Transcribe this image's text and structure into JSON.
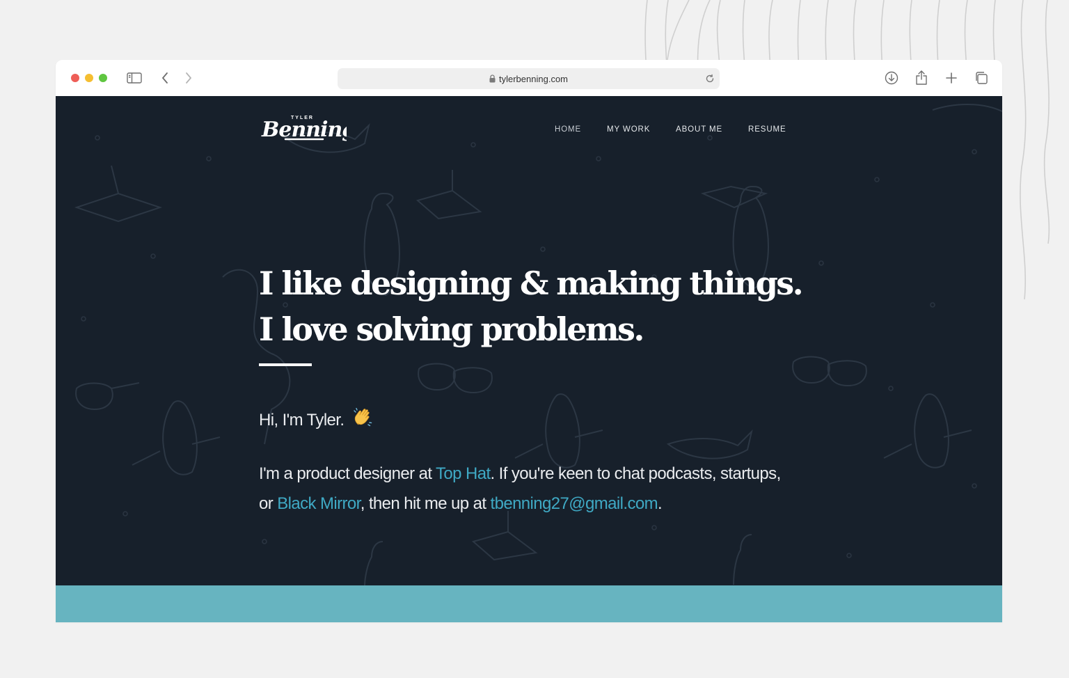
{
  "browser": {
    "url": "tylerbenning.com",
    "icons": [
      "sidebar-icon",
      "back-icon",
      "forward-icon",
      "lock-icon",
      "reload-icon",
      "download-icon",
      "share-icon",
      "new-tab-icon",
      "tabs-overview-icon"
    ]
  },
  "site": {
    "logo": {
      "small_text": "TYLER",
      "script_text": "Benning"
    },
    "nav": [
      "HOME",
      "MY WORK",
      "ABOUT ME",
      "RESUME"
    ],
    "headline": [
      "I like designing & making things.",
      "I love solving problems."
    ],
    "greeting": "Hi, I'm Tyler.",
    "greeting_emoji": "waving-hand-icon",
    "bio": {
      "part1": "I'm a product designer at ",
      "link1": "Top Hat",
      "part2": ". If you're keen to chat podcasts, startups, or ",
      "link2": "Black Mirror",
      "part3": ", then hit me up at ",
      "link3": "tbenning27@gmail.com",
      "part4": "."
    }
  },
  "colors": {
    "site_bg": "#17202b",
    "link": "#3fa9c4",
    "band": "#67b4c0",
    "page_bg": "#f1f1f1"
  }
}
